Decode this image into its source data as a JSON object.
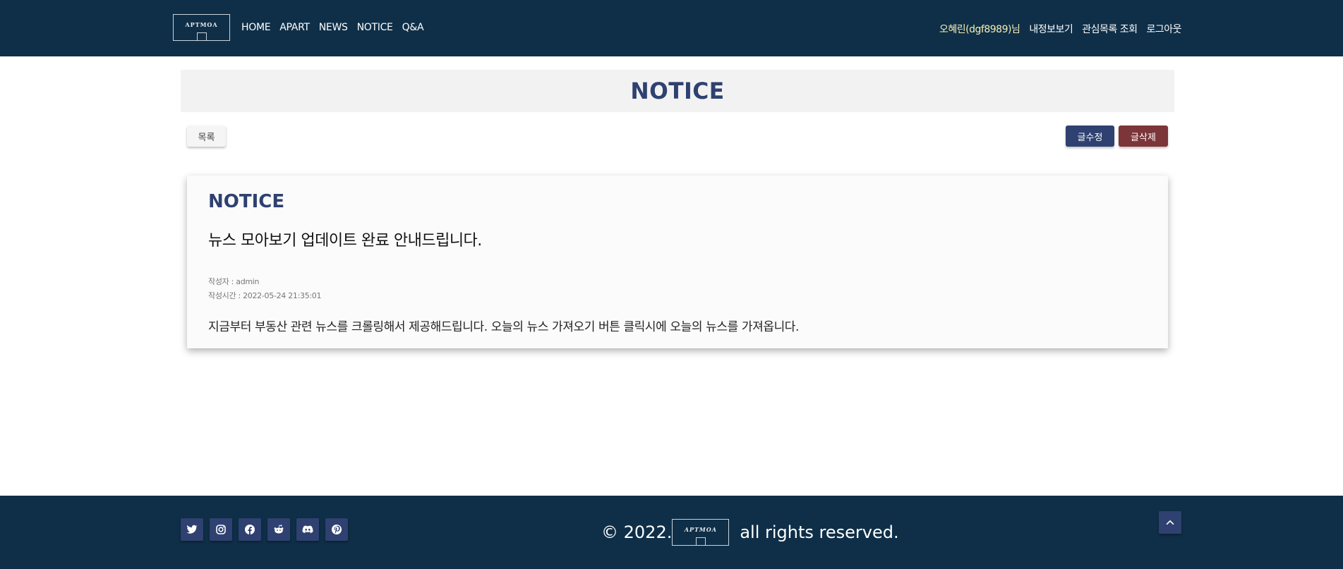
{
  "header": {
    "logo_text": "APTMOA",
    "nav": [
      "HOME",
      "APART",
      "NEWS",
      "NOTICE",
      "Q&A"
    ],
    "user": {
      "greeting": "오혜린(dgf8989)님",
      "my_info": "내정보보기",
      "watchlist": "관심목록 조회",
      "logout": "로그아웃"
    }
  },
  "page": {
    "title": "NOTICE",
    "list_button": "목록",
    "edit_button": "글수정",
    "delete_button": "글삭제"
  },
  "post": {
    "category": "NOTICE",
    "title": "뉴스 모아보기 업데이트 완료 안내드립니다.",
    "author": "작성자 : admin",
    "created": "작성시간 : 2022-05-24 21:35:01",
    "body": "지금부터 부동산 관련 뉴스를 크롤링해서 제공해드립니다. 오늘의 뉴스 가져오기 버튼 클릭시에 오늘의 뉴스를 가져옵니다."
  },
  "footer": {
    "copyright_prefix": "© 2022.",
    "logo_text": "APTMOA",
    "copyright_suffix": "all rights reserved.",
    "social": [
      "twitter-icon",
      "instagram-icon",
      "facebook-icon",
      "reddit-icon",
      "discord-icon",
      "pinterest-icon"
    ],
    "to_top_icon": "chevron-up-icon"
  },
  "colors": {
    "navy": "#0f2f48",
    "accent": "#2e4170",
    "danger": "#7c3538",
    "greeting": "#f4efb4"
  }
}
